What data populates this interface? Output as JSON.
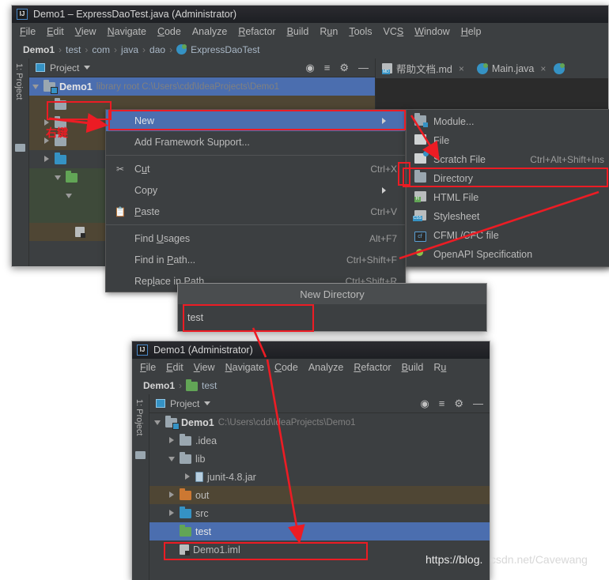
{
  "window1": {
    "title": "Demo1 – ExpressDaoTest.java (Administrator)",
    "logo": "intellij-idea-logo",
    "menubar": [
      "File",
      "Edit",
      "View",
      "Navigate",
      "Code",
      "Analyze",
      "Refactor",
      "Build",
      "Run",
      "Tools",
      "VCS",
      "Window",
      "Help"
    ],
    "breadcrumb": [
      "Demo1",
      "test",
      "com",
      "java",
      "dao",
      "ExpressDaoTest"
    ],
    "toolwindow": {
      "label": "Project",
      "vertical_label": "1: Project",
      "icons": [
        "locate-icon",
        "collapse-all-icon",
        "gear-icon",
        "minimize-icon"
      ]
    },
    "tabs": [
      {
        "label": "帮助文档.md",
        "icon": "markdown-file-icon",
        "close": "×"
      },
      {
        "label": "Main.java",
        "icon": "java-file-icon",
        "close": "×"
      },
      {
        "label": "",
        "icon": "java-file-icon",
        "close": ""
      }
    ],
    "tree": {
      "root_label": "Demo1",
      "root_path": "library root  C:\\Users\\cdd\\IdeaProjects\\Demo1"
    }
  },
  "context_menu": {
    "items": [
      {
        "label": "New",
        "accel": "",
        "icon": "",
        "submenu": true,
        "selected": true
      },
      {
        "label": "Add Framework Support...",
        "accel": "",
        "icon": "",
        "submenu": false,
        "selected": false
      },
      {
        "label": "Cut",
        "accel": "Ctrl+X",
        "icon": "scissors-icon",
        "submenu": false,
        "selected": false
      },
      {
        "label": "Copy",
        "accel": "",
        "icon": "",
        "submenu": true,
        "selected": false
      },
      {
        "label": "Paste",
        "accel": "Ctrl+V",
        "icon": "clipboard-icon",
        "submenu": false,
        "selected": false
      },
      {
        "label": "Find Usages",
        "accel": "Alt+F7",
        "icon": "",
        "submenu": false,
        "selected": false
      },
      {
        "label": "Find in Path...",
        "accel": "Ctrl+Shift+F",
        "icon": "",
        "submenu": false,
        "selected": false
      },
      {
        "label": "Replace in Path...",
        "accel": "Ctrl+Shift+R",
        "icon": "",
        "submenu": false,
        "selected": false
      }
    ]
  },
  "submenu": {
    "items": [
      {
        "label": "Module...",
        "accel": "",
        "icon": "module-folder-icon",
        "highlighted": false
      },
      {
        "label": "File",
        "accel": "",
        "icon": "file-icon",
        "highlighted": false
      },
      {
        "label": "Scratch File",
        "accel": "Ctrl+Alt+Shift+Ins",
        "icon": "scratch-file-icon",
        "highlighted": false
      },
      {
        "label": "Directory",
        "accel": "",
        "icon": "directory-icon",
        "highlighted": true
      },
      {
        "label": "HTML File",
        "accel": "",
        "icon": "html-file-icon",
        "highlighted": false
      },
      {
        "label": "Stylesheet",
        "accel": "",
        "icon": "css-file-icon",
        "highlighted": false
      },
      {
        "label": "CFML/CFC file",
        "accel": "",
        "icon": "cfml-file-icon",
        "highlighted": false
      },
      {
        "label": "OpenAPI Specification",
        "accel": "",
        "icon": "openapi-icon",
        "highlighted": false
      }
    ]
  },
  "dialog": {
    "title": "New Directory",
    "input_value": "test",
    "input_placeholder": ""
  },
  "window2": {
    "title": "Demo1 (Administrator)",
    "logo": "intellij-idea-logo",
    "menubar": [
      "File",
      "Edit",
      "View",
      "Navigate",
      "Code",
      "Analyze",
      "Refactor",
      "Build",
      "Ru"
    ],
    "breadcrumb": [
      "Demo1",
      "test"
    ],
    "toolwindow": {
      "label": "Project",
      "vertical_label": "1: Project",
      "icons": [
        "locate-icon",
        "collapse-all-icon",
        "gear-icon",
        "minimize-icon"
      ]
    },
    "tree": [
      {
        "label": "Demo1",
        "path": "C:\\Users\\cdd\\IdeaProjects\\Demo1",
        "indent": 0,
        "arrow": "down",
        "icon": "module-folder-icon",
        "bold": true,
        "state": "normal"
      },
      {
        "label": ".idea",
        "path": "",
        "indent": 1,
        "arrow": "right",
        "icon": "grey-folder-icon",
        "bold": false,
        "state": "normal"
      },
      {
        "label": "lib",
        "path": "",
        "indent": 1,
        "arrow": "down",
        "icon": "grey-folder-icon",
        "bold": false,
        "state": "normal"
      },
      {
        "label": "junit-4.8.jar",
        "path": "",
        "indent": 2,
        "arrow": "right",
        "icon": "jar-icon",
        "bold": false,
        "state": "normal"
      },
      {
        "label": "out",
        "path": "",
        "indent": 1,
        "arrow": "right",
        "icon": "orange-folder-icon",
        "bold": false,
        "state": "excluded"
      },
      {
        "label": "src",
        "path": "",
        "indent": 1,
        "arrow": "right",
        "icon": "blue-folder-icon",
        "bold": false,
        "state": "normal"
      },
      {
        "label": "test",
        "path": "",
        "indent": 1,
        "arrow": "none",
        "icon": "green-folder-icon",
        "bold": false,
        "state": "selected"
      },
      {
        "label": "Demo1.iml",
        "path": "",
        "indent": 1,
        "arrow": "none",
        "icon": "iml-file-icon",
        "bold": false,
        "state": "normal"
      }
    ]
  },
  "annotations": {
    "right_click_label": "右键",
    "color_red": "#ec1c24",
    "boxes": [
      "new-menu-item-box",
      "directory-menu-item-box",
      "demo1-root-box",
      "dialog-input-box",
      "test-folder-box"
    ]
  },
  "watermark": {
    "text_part1": "https://blog.",
    "text_part2": "csdn.net/Cavewang",
    "full": "https://blog.csdn.net/Cavewang"
  },
  "colors": {
    "accent_blue": "#4b6eaf",
    "panel_bg": "#3c3f41",
    "title_bg": "#1d1f23",
    "red": "#ec1c24",
    "green_folder": "#62a556",
    "orange_folder": "#cc7832",
    "blue_folder": "#3592c4"
  }
}
